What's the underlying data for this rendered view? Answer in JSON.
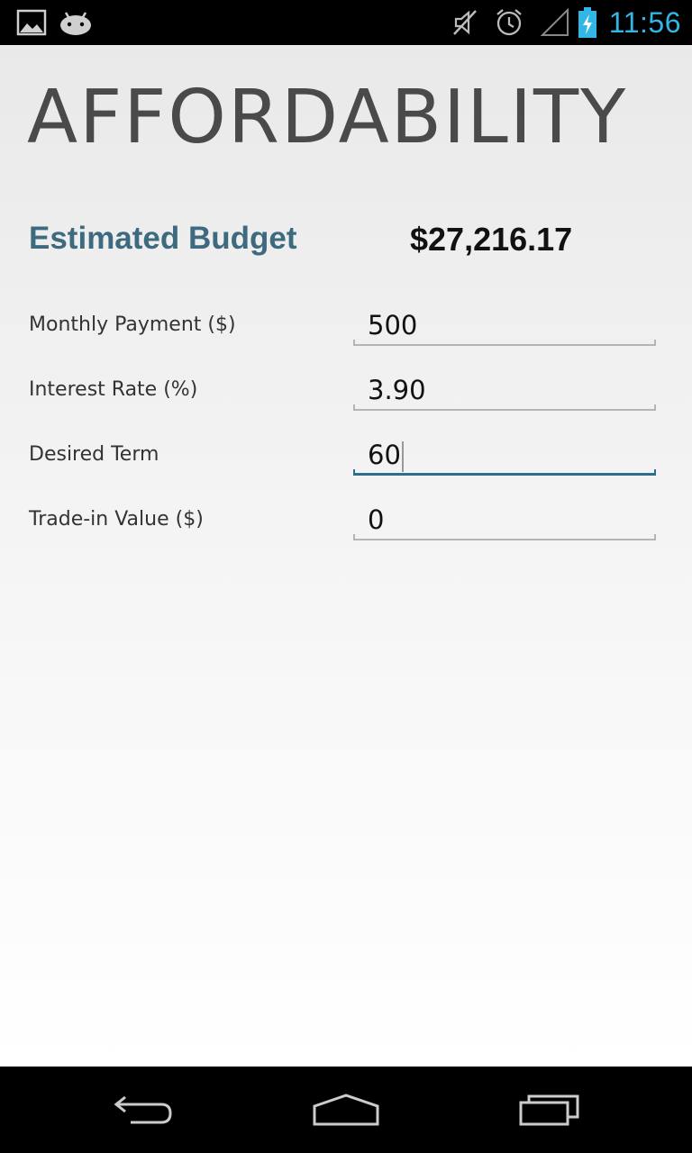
{
  "status_bar": {
    "time": "11:56",
    "icons_left": [
      "gallery-icon",
      "android-icon"
    ],
    "icons_right": [
      "mute-icon",
      "alarm-icon",
      "signal-icon",
      "battery-charging-icon"
    ],
    "accent_color": "#33b5e5"
  },
  "page": {
    "title": "AFFORDABILITY",
    "budget_label": "Estimated Budget",
    "budget_value": "$27,216.17"
  },
  "form": {
    "rows": [
      {
        "label": "Monthly Payment ($)",
        "value": "500"
      },
      {
        "label": "Interest Rate (%)",
        "value": "3.90"
      },
      {
        "label": "Desired Term",
        "value": "60"
      },
      {
        "label": "Trade-in Value ($)",
        "value": "0"
      }
    ]
  },
  "nav_bar": {
    "buttons": [
      "back-icon",
      "home-icon",
      "recent-apps-icon"
    ]
  },
  "colors": {
    "label_accent": "#3e6a7f",
    "focus_underline": "#2f6d8e"
  }
}
